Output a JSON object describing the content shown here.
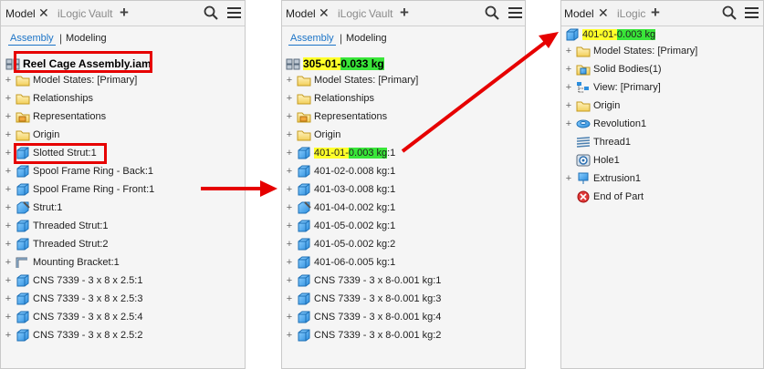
{
  "panel1": {
    "tabs": [
      "Model",
      "iLogic",
      "Vault"
    ],
    "subtabs": {
      "assembly": "Assembly",
      "modeling": "Modeling"
    },
    "root": "Reel Cage Assembly.iam",
    "items": [
      {
        "label": "Model States: [Primary]",
        "icon": "folder-icon"
      },
      {
        "label": "Relationships",
        "icon": "folder-icon"
      },
      {
        "label": "Representations",
        "icon": "folder-icon"
      },
      {
        "label": "Origin",
        "icon": "folder-icon"
      },
      {
        "label": "Slotted Strut:1",
        "icon": "part-icon"
      },
      {
        "label": "Spool Frame Ring - Back:1",
        "icon": "part-icon"
      },
      {
        "label": "Spool Frame Ring - Front:1",
        "icon": "part-icon"
      },
      {
        "label": "Strut:1",
        "icon": "part-icon"
      },
      {
        "label": "Threaded Strut:1",
        "icon": "part-icon"
      },
      {
        "label": "Threaded Strut:2",
        "icon": "part-icon"
      },
      {
        "label": "Mounting Bracket:1",
        "icon": "bracket-icon"
      },
      {
        "label": "CNS 7339 - 3 x 8 x 2.5:1",
        "icon": "part-icon"
      },
      {
        "label": "CNS 7339 - 3 x 8 x 2.5:3",
        "icon": "part-icon"
      },
      {
        "label": "CNS 7339 - 3 x 8 x 2.5:4",
        "icon": "part-icon"
      },
      {
        "label": "CNS 7339 - 3 x 8 x 2.5:2",
        "icon": "part-icon"
      }
    ]
  },
  "panel2": {
    "tabs": [
      "Model",
      "iLogic",
      "Vault"
    ],
    "subtabs": {
      "assembly": "Assembly",
      "modeling": "Modeling"
    },
    "root_part1": "305-01-",
    "root_part2": "0.033 kg",
    "items": [
      {
        "label": "Model States: [Primary]"
      },
      {
        "label": "Relationships"
      },
      {
        "label": "Representations"
      },
      {
        "label": "Origin"
      },
      {
        "label": "401-02-0.008 kg:1"
      },
      {
        "label": "401-03-0.008 kg:1"
      },
      {
        "label": "401-04-0.002 kg:1"
      },
      {
        "label": "401-05-0.002 kg:1"
      },
      {
        "label": "401-05-0.002 kg:2"
      },
      {
        "label": "401-06-0.005 kg:1"
      },
      {
        "label": "CNS 7339 - 3 x 8-0.001 kg:1"
      },
      {
        "label": "CNS 7339 - 3 x 8-0.001 kg:3"
      },
      {
        "label": "CNS 7339 - 3 x 8-0.001 kg:4"
      },
      {
        "label": "CNS 7339 - 3 x 8-0.001 kg:2"
      }
    ],
    "hl_item_part1": "401-01-",
    "hl_item_part2": "0.003 kg",
    "hl_item_suffix": ":1"
  },
  "panel3": {
    "tabs": [
      "Model",
      "iLogic"
    ],
    "root_part1": "401-01-",
    "root_part2": "0.003 kg",
    "items": [
      {
        "label": "Model States: [Primary]"
      },
      {
        "label": "Solid Bodies(1)"
      },
      {
        "label": "View: [Primary]"
      },
      {
        "label": "Origin"
      },
      {
        "label": "Revolution1"
      },
      {
        "label": "Thread1"
      },
      {
        "label": "Hole1"
      },
      {
        "label": "Extrusion1"
      },
      {
        "label": "End of Part"
      }
    ]
  },
  "colors": {
    "highlight_yellow": "#ffff29",
    "highlight_green": "#39e639",
    "arrow_red": "#e60000",
    "active_blue": "#1c74c7"
  }
}
